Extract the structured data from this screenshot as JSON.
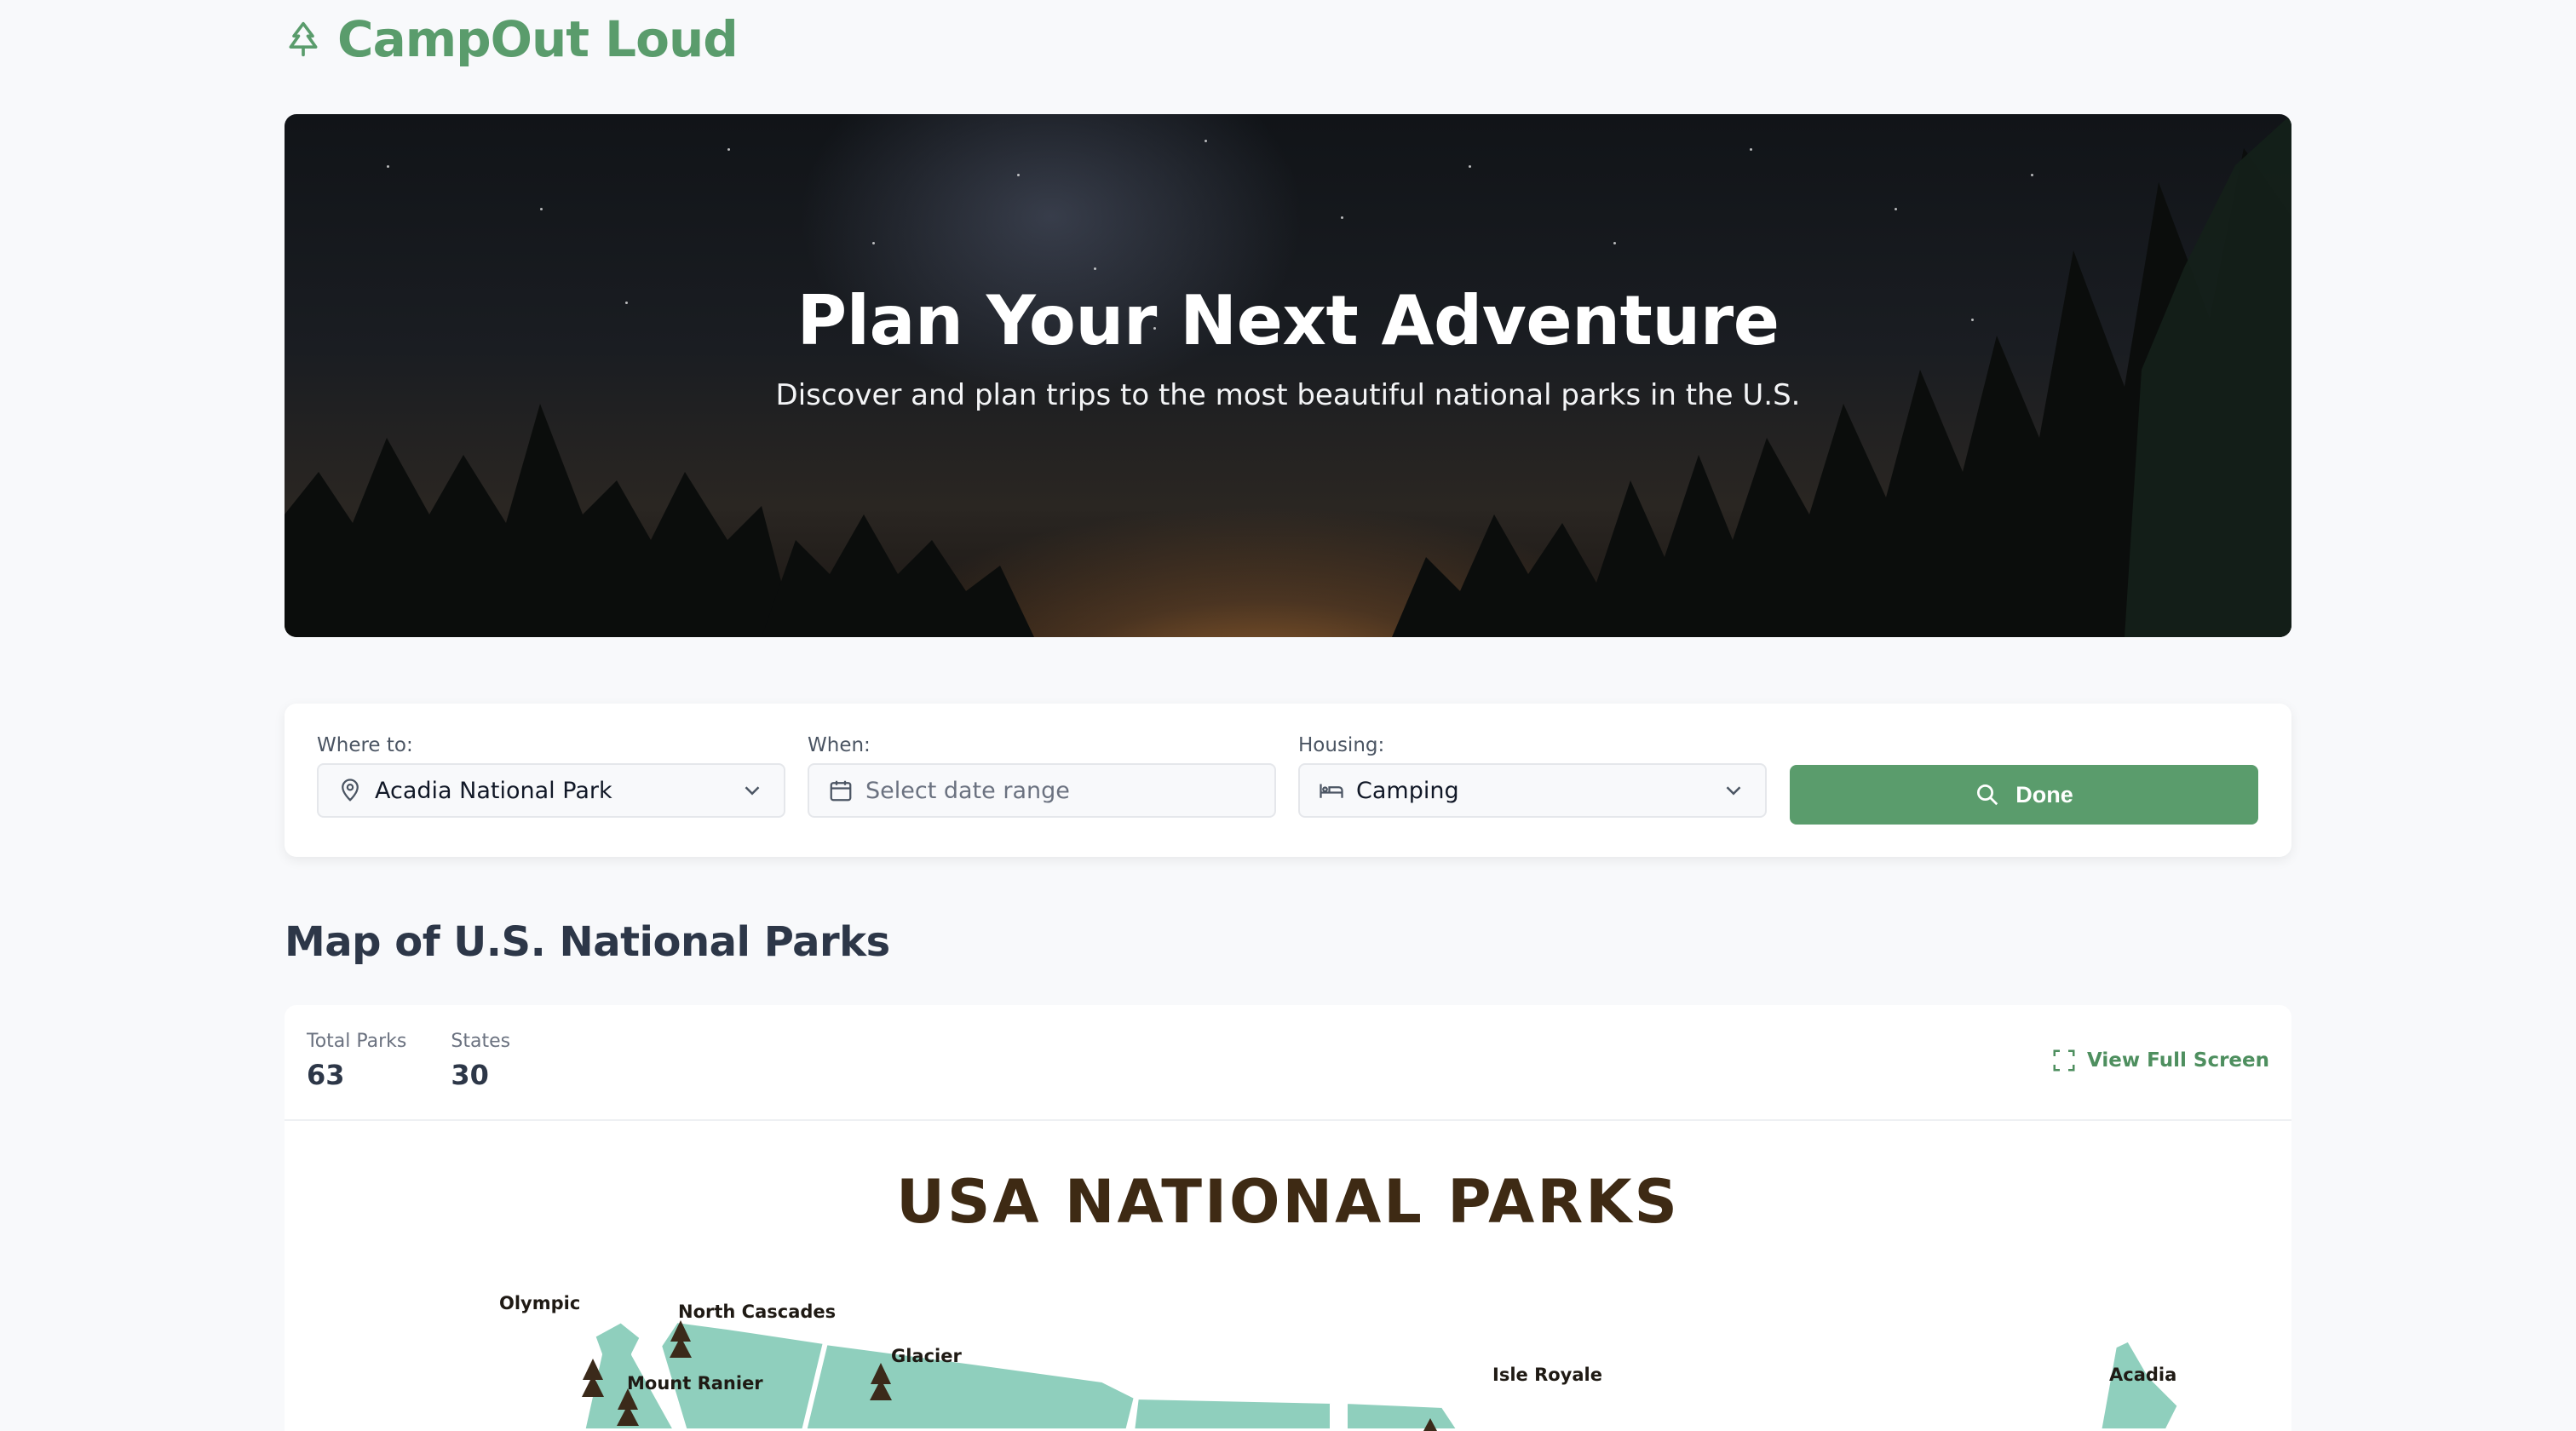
{
  "brand": {
    "name": "CampOut Loud",
    "icon": "pine-tree-icon",
    "color": "#5a9c6c"
  },
  "hero": {
    "title": "Plan Your Next Adventure",
    "subtitle": "Discover and plan trips to the most beautiful national parks in the U.S."
  },
  "search": {
    "where": {
      "label": "Where to:",
      "value": "Acadia National Park",
      "icon": "map-pin-icon"
    },
    "when": {
      "label": "When:",
      "placeholder": "Select date range",
      "icon": "calendar-icon"
    },
    "housing": {
      "label": "Housing:",
      "value": "Camping",
      "icon": "bed-icon"
    },
    "submit": {
      "label": "Done",
      "icon": "search-icon",
      "color": "#5a9c6c"
    }
  },
  "map_section": {
    "title": "Map of U.S. National Parks",
    "stats": [
      {
        "label": "Total Parks",
        "value": "63"
      },
      {
        "label": "States",
        "value": "30"
      }
    ],
    "fullscreen_label": "View Full Screen",
    "map_title": "USA NATIONAL PARKS",
    "parks": [
      "Olympic",
      "North Cascades",
      "Glacier",
      "Mount Ranier",
      "Isle Royale",
      "Acadia"
    ],
    "map_color": "#8fcfbd"
  }
}
